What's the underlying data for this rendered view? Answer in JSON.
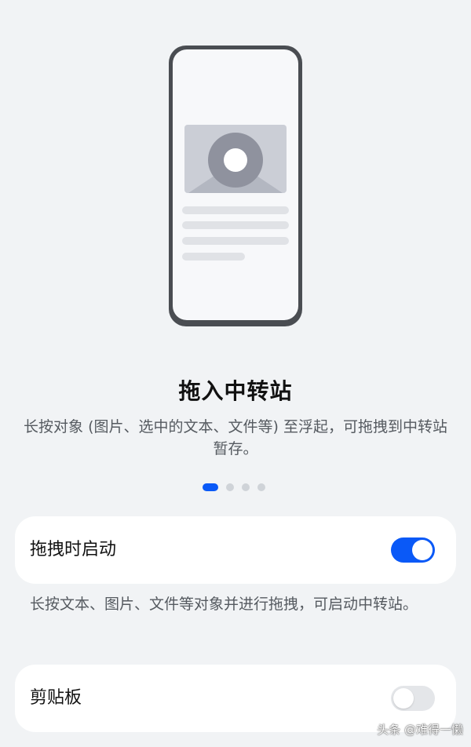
{
  "illustration": {
    "icon": "phone-with-image-illustration"
  },
  "feature": {
    "title": "拖入中转站",
    "description": "长按对象 (图片、选中的文本、文件等) 至浮起，可拖拽到中转站暂存。"
  },
  "pagination": {
    "total": 4,
    "current": 1
  },
  "settings": {
    "drag_launch": {
      "label": "拖拽时启动",
      "enabled": true
    },
    "drag_launch_hint": "长按文本、图片、文件等对象并进行拖拽，可启动中转站。",
    "clipboard": {
      "label": "剪贴板",
      "enabled": false
    }
  },
  "watermark": "头条 @难得一懒",
  "colors": {
    "accent": "#0a59f7",
    "background": "#f1f3f5",
    "card": "#ffffff"
  }
}
